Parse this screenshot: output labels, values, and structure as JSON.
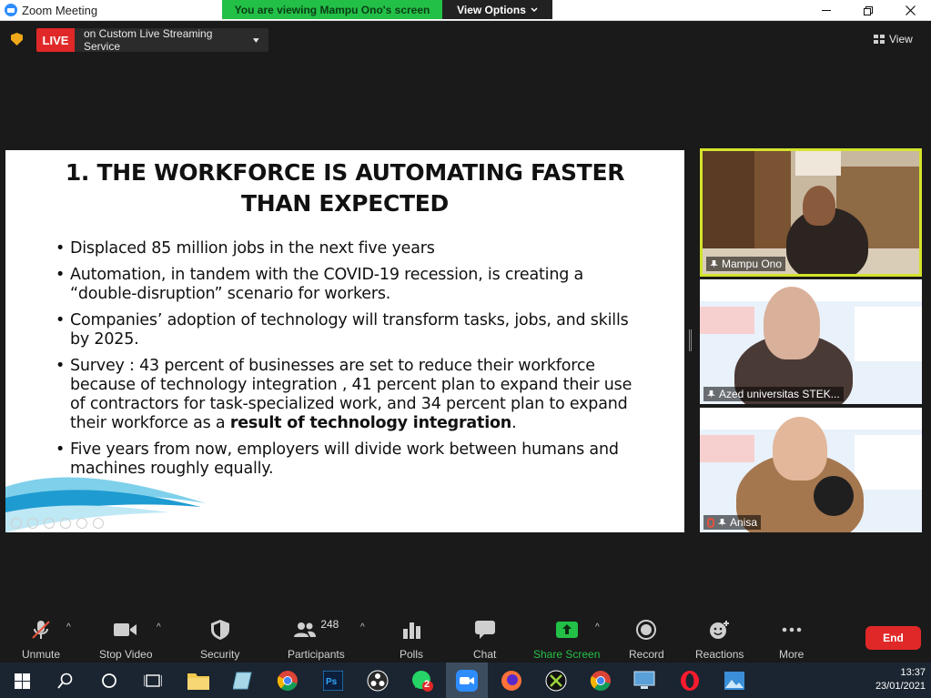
{
  "window": {
    "title": "Zoom Meeting",
    "viewing_banner": "You are viewing Mampu Ono's screen",
    "view_options": "View Options"
  },
  "live": {
    "badge": "LIVE",
    "service": "on Custom Live Streaming Service"
  },
  "view_button": "View",
  "slide": {
    "title_line1": "1. THE WORKFORCE IS AUTOMATING FASTER",
    "title_line2": "THAN EXPECTED",
    "bullets": [
      "Displaced  85 million jobs in the next five years",
      "Automation, in tandem with the COVID-19 recession, is creating a “double-disruption” scenario for workers.",
      "Companies’ adoption of technology will transform tasks, jobs, and skills by 2025.",
      "Survey : 43 percent of businesses are set to reduce their workforce because of technology integration , 41 percent plan to expand their use of contractors for task-specialized work, and 34 percent plan to expand their workforce as a ",
      "Five years from now, employers will divide work between humans and machines roughly equally."
    ],
    "bold_tail": "result of technology integration",
    "bold_tail_end": "."
  },
  "participants_tiles": [
    {
      "name": "Mampu Ono"
    },
    {
      "name": "Azed universitas STEK..."
    },
    {
      "name": "Anisa"
    }
  ],
  "toolbar": {
    "unmute": "Unmute",
    "stop_video": "Stop Video",
    "security": "Security",
    "participants": "Participants",
    "participants_count": "248",
    "polls": "Polls",
    "chat": "Chat",
    "share_screen": "Share Screen",
    "record": "Record",
    "reactions": "Reactions",
    "more": "More",
    "end": "End"
  },
  "taskbar": {
    "time": "13:37",
    "date": "23/01/2021",
    "whatsapp_badge": "2"
  },
  "colors": {
    "live_red": "#e02828",
    "banner_green": "#23c047",
    "active_speaker": "#d4e32c",
    "share_green": "#23c047"
  }
}
